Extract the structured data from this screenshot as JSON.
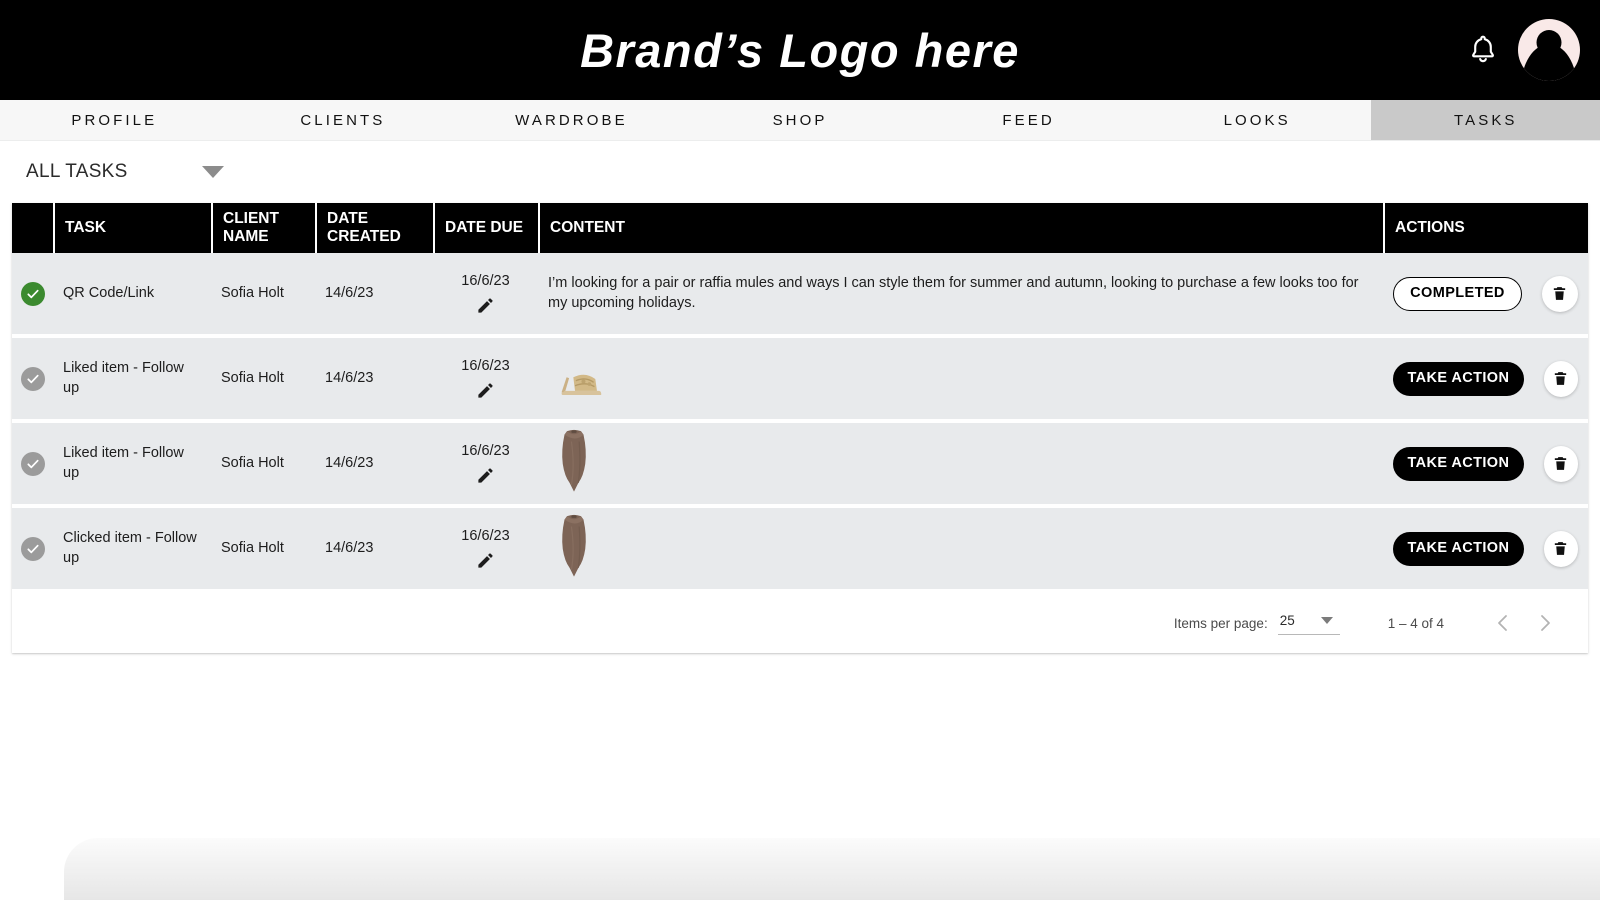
{
  "header": {
    "logo": "Brand’s Logo here",
    "bell_icon": "bell-icon",
    "avatar_icon": "avatar",
    "brand_bg": "#000000",
    "avatar_bg": "#f9e9e8"
  },
  "nav": {
    "items": [
      {
        "label": "PROFILE",
        "active": false
      },
      {
        "label": "CLIENTS",
        "active": false
      },
      {
        "label": "WARDROBE",
        "active": false
      },
      {
        "label": "SHOP",
        "active": false
      },
      {
        "label": "FEED",
        "active": false
      },
      {
        "label": "LOOKS",
        "active": false
      },
      {
        "label": "TASKS",
        "active": true
      }
    ],
    "active_bg": "#c9c9c9",
    "bar_bg": "#f7f7f7"
  },
  "filter": {
    "label": "ALL TASKS",
    "caret_icon": "chevron-down-icon"
  },
  "table": {
    "columns": {
      "status": "",
      "task": "TASK",
      "client_name": "CLIENT NAME",
      "date_created": "DATE CREATED",
      "date_due": "DATE DUE",
      "content": "CONTENT",
      "actions": "ACTIONS"
    },
    "header_bg": "#000000",
    "row_bg": "#e8eaec",
    "rows": [
      {
        "status": "completed",
        "status_color": "#3b8a2f",
        "task": "QR Code/Link",
        "client_name": "Sofia Holt",
        "date_created": "14/6/23",
        "date_due": "16/6/23",
        "edit_icon": "pencil-icon",
        "content_type": "text",
        "content_text": "I’m looking for a pair or raffia mules and ways I can style them for summer and autumn, looking to purchase a few looks too for my upcoming holidays.",
        "content_image": "",
        "action_label": "COMPLETED",
        "action_style": "outline",
        "delete_icon": "trash-icon"
      },
      {
        "status": "pending",
        "status_color": "#9b9b9b",
        "task": "Liked item - Follow up",
        "client_name": "Sofia Holt",
        "date_created": "14/6/23",
        "date_due": "16/6/23",
        "edit_icon": "pencil-icon",
        "content_type": "image",
        "content_text": "",
        "content_image": "raffia-mule-heeled-sandal",
        "action_label": "TAKE ACTION",
        "action_style": "filled",
        "delete_icon": "trash-icon"
      },
      {
        "status": "pending",
        "status_color": "#9b9b9b",
        "task": "Liked item - Follow up",
        "client_name": "Sofia Holt",
        "date_created": "14/6/23",
        "date_due": "16/6/23",
        "edit_icon": "pencil-icon",
        "content_type": "image",
        "content_text": "",
        "content_image": "brown-sleeveless-bodysuit",
        "action_label": "TAKE ACTION",
        "action_style": "filled",
        "delete_icon": "trash-icon"
      },
      {
        "status": "pending",
        "status_color": "#9b9b9b",
        "task": "Clicked item - Follow up",
        "client_name": "Sofia Holt",
        "date_created": "14/6/23",
        "date_due": "16/6/23",
        "edit_icon": "pencil-icon",
        "content_type": "image",
        "content_text": "",
        "content_image": "brown-sleeveless-bodysuit",
        "action_label": "TAKE ACTION",
        "action_style": "filled",
        "delete_icon": "trash-icon"
      }
    ]
  },
  "paginator": {
    "items_per_page_label": "Items per page:",
    "items_per_page_value": "25",
    "range_label": "1 – 4 of 4",
    "prev_icon": "chevron-left-icon",
    "next_icon": "chevron-right-icon"
  }
}
